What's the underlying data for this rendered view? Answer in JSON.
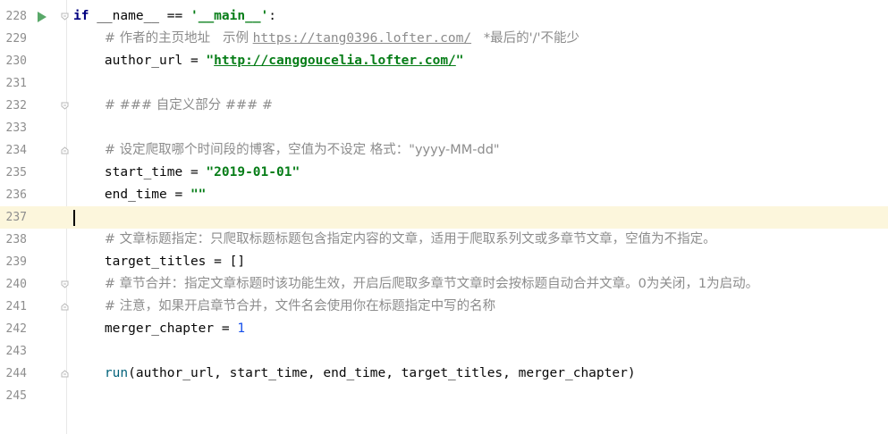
{
  "editor": {
    "colors": {
      "keyword": "#000080",
      "string": "#067d17",
      "comment": "#8c8c8c",
      "number": "#1750eb",
      "function": "#00627a",
      "current_line": "#fcf6dc",
      "line_number": "#8e8e8e",
      "run_icon": "#59a869"
    },
    "lines": [
      {
        "num": "228",
        "run_icon": "run-icon",
        "fold_icon": "fold-open-icon",
        "tokens": {
          "if": "if",
          "name": " __name__ ",
          "eq": "== ",
          "main": "'__main__'",
          "colon": ":"
        }
      },
      {
        "num": "229",
        "tokens": {
          "indent": "    ",
          "comment1": "# 作者的主页地址   示例 ",
          "url": "https://tang0396.lofter.com/",
          "comment2": "   *最后的'/'不能少"
        }
      },
      {
        "num": "230",
        "tokens": {
          "indent": "    ",
          "var": "author_url = ",
          "quote_open": "\"",
          "url": "http://canggoucelia.lofter.com/",
          "quote_close": "\""
        }
      },
      {
        "num": "231"
      },
      {
        "num": "232",
        "fold_icon": "fold-open-icon",
        "tokens": {
          "indent": "    ",
          "comment": "# ### 自定义部分 ### #"
        }
      },
      {
        "num": "233"
      },
      {
        "num": "234",
        "fold_icon": "fold-close-icon",
        "tokens": {
          "indent": "    ",
          "comment": "# 设定爬取哪个时间段的博客，空值为不设定 格式：\"yyyy-MM-dd\""
        }
      },
      {
        "num": "235",
        "tokens": {
          "indent": "    ",
          "var": "start_time = ",
          "str": "\"2019-01-01\""
        }
      },
      {
        "num": "236",
        "tokens": {
          "indent": "    ",
          "var": "end_time = ",
          "str": "\"\""
        }
      },
      {
        "num": "237",
        "current": true
      },
      {
        "num": "238",
        "tokens": {
          "indent": "    ",
          "comment": "# 文章标题指定：只爬取标题标题包含指定内容的文章，适用于爬取系列文或多章节文章，空值为不指定。"
        }
      },
      {
        "num": "239",
        "tokens": {
          "indent": "    ",
          "var": "target_titles = ",
          "punc": "[]"
        }
      },
      {
        "num": "240",
        "fold_icon": "fold-open-icon",
        "tokens": {
          "indent": "    ",
          "comment": "# 章节合并：指定文章标题时该功能生效，开启后爬取多章节文章时会按标题自动合并文章。0为关闭，1为启动。"
        }
      },
      {
        "num": "241",
        "fold_icon": "fold-close-icon",
        "tokens": {
          "indent": "    ",
          "comment": "# 注意，如果开启章节合并，文件名会使用你在标题指定中写的名称"
        }
      },
      {
        "num": "242",
        "tokens": {
          "indent": "    ",
          "var": "merger_chapter = ",
          "num": "1"
        }
      },
      {
        "num": "243"
      },
      {
        "num": "244",
        "fold_icon": "fold-close-icon",
        "tokens": {
          "indent": "    ",
          "fn": "run",
          "open": "(",
          "args": "author_url, start_time, end_time, target_titles, merger_chapter",
          "close": ")"
        }
      },
      {
        "num": "245"
      }
    ]
  }
}
